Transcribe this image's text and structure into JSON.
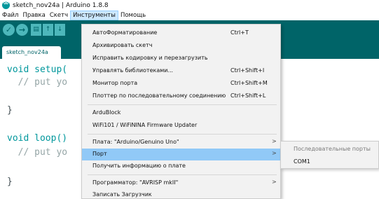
{
  "window": {
    "title": "sketch_nov24a | Arduino 1.8.8"
  },
  "menubar": {
    "items": [
      "Файл",
      "Правка",
      "Скетч",
      "Инструменты",
      "Помощь"
    ],
    "active_index": 3
  },
  "toolbar": {
    "buttons": [
      "verify",
      "upload",
      "new",
      "open",
      "save"
    ]
  },
  "tabs": [
    {
      "label": "sketch_nov24a"
    }
  ],
  "editor": {
    "lines": [
      "void setup(",
      "  // put yo",
      "}",
      "void loop()",
      "  // put yo",
      "}"
    ]
  },
  "tools_menu": {
    "items": [
      {
        "label": "АвтоФорматирование",
        "shortcut": "Ctrl+T"
      },
      {
        "label": "Архивировать скетч",
        "shortcut": ""
      },
      {
        "label": "Исправить кодировку и перезагрузить",
        "shortcut": ""
      },
      {
        "label": "Управлять библиотеками...",
        "shortcut": "Ctrl+Shift+I"
      },
      {
        "label": "Монитор порта",
        "shortcut": "Ctrl+Shift+M"
      },
      {
        "label": "Плоттер по последовательному соединению",
        "shortcut": "Ctrl+Shift+L"
      },
      {
        "label": "ArduBlock",
        "shortcut": ""
      },
      {
        "label": "WiFi101 / WiFiNINA Firmware Updater",
        "shortcut": ""
      },
      {
        "label": "Плата: \"Arduino/Genuino Uno\"",
        "shortcut": ""
      },
      {
        "label": "Порт",
        "shortcut": ""
      },
      {
        "label": "Получить информацию о плате",
        "shortcut": ""
      },
      {
        "label": "Программатор: \"AVRISP mkII\"",
        "shortcut": ""
      },
      {
        "label": "Записать Загрузчик",
        "shortcut": ""
      }
    ],
    "submenu_arrow": ">"
  },
  "port_submenu": {
    "header": "Последовательные порты",
    "ports": [
      "COM1"
    ]
  },
  "colors": {
    "toolbar_bg": "#006468",
    "menu_highlight": "#91c9f7",
    "keyword": "#00979c"
  }
}
